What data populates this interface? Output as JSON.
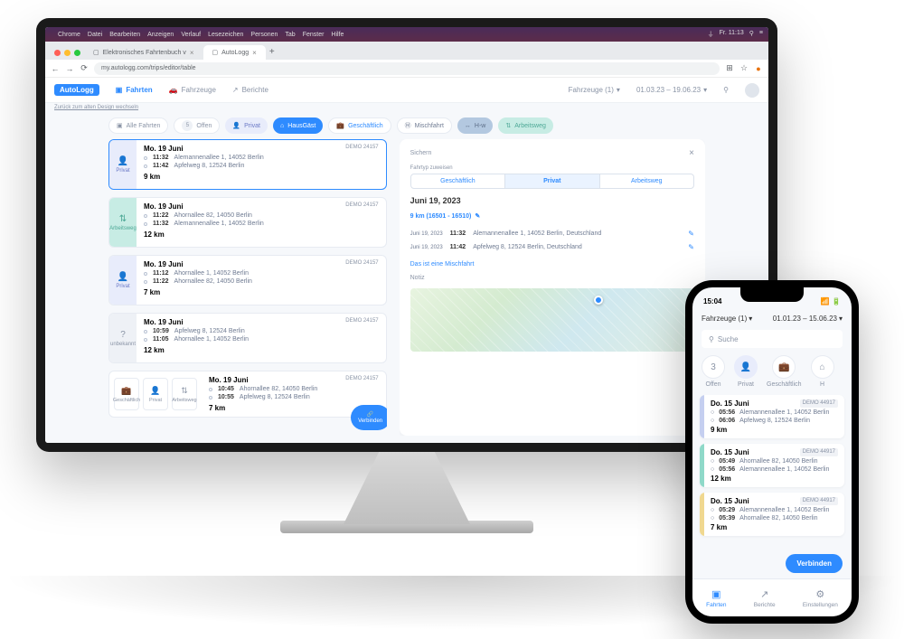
{
  "mac_menu": {
    "app": "Chrome",
    "items": [
      "Datei",
      "Bearbeiten",
      "Anzeigen",
      "Verlauf",
      "Lesezeichen",
      "Personen",
      "Tab",
      "Fenster",
      "Hilfe"
    ],
    "time": "Fr. 11:13"
  },
  "chrome": {
    "tabs": [
      {
        "title": "Elektronisches Fahrtenbuch v"
      },
      {
        "title": "AutoLogg"
      }
    ],
    "url": "my.autologg.com/trips/editor/table"
  },
  "header": {
    "logo": "AutoLogg",
    "nav_fahrten": "Fahrten",
    "nav_fahrzeuge": "Fahrzeuge",
    "nav_berichte": "Berichte",
    "vehicle_sel": "Fahrzeuge (1)",
    "date_range": "01.03.23 – 19.06.23",
    "back_link": "Zurück zum alten Design wechseln"
  },
  "filters": {
    "alle": "Alle Fahrten",
    "offen": "Offen",
    "offen_n": "5",
    "privat": "Privat",
    "hausgast": "HausGäst",
    "geschaeftlich": "Geschäftlich",
    "mischfahrt": "Mischfahrt",
    "hinweg": "H-w",
    "arbeitsweg": "Arbeitsweg"
  },
  "trips": [
    {
      "side": "Privat",
      "date": "Mo. 19 Juni",
      "demo": "DEMO 24157",
      "t1": "11:32",
      "a1": "Alemannenallee 1, 14052 Berlin",
      "t2": "11:42",
      "a2": "Apfelweg 8, 12524 Berlin",
      "km": "9 km"
    },
    {
      "side": "Arbeitsweg",
      "date": "Mo. 19 Juni",
      "demo": "DEMO 24157",
      "t1": "11:22",
      "a1": "Ahornallee 82, 14050 Berlin",
      "t2": "11:32",
      "a2": "Alemannenallee 1, 14052 Berlin",
      "km": "12 km"
    },
    {
      "side": "Privat",
      "date": "Mo. 19 Juni",
      "demo": "DEMO 24157",
      "t1": "11:12",
      "a1": "Ahornallee 1, 14052 Berlin",
      "t2": "11:22",
      "a2": "Ahornallee 82, 14050 Berlin",
      "km": "7 km"
    },
    {
      "side": "unbekannt",
      "date": "Mo. 19 Juni",
      "demo": "DEMO 24157",
      "t1": "10:59",
      "a1": "Apfelweg 8, 12524 Berlin",
      "t2": "11:05",
      "a2": "Ahornallee 1, 14052 Berlin",
      "km": "12 km"
    },
    {
      "side": "",
      "date": "Mo. 19 Juni",
      "demo": "DEMO 24157",
      "t1": "10:45",
      "a1": "Ahornallee 82, 14050 Berlin",
      "t2": "10:55",
      "a2": "Apfelweg 8, 12524 Berlin",
      "km": "7 km"
    }
  ],
  "cat_labels": {
    "ges": "Geschäftlich",
    "priv": "Privat",
    "arb": "Arbeitsweg"
  },
  "verbinden": "Verbinden",
  "detail": {
    "sichern": "Sichern",
    "label_typ": "Fahrtyp zuweisen",
    "seg_ges": "Geschäftlich",
    "seg_priv": "Privat",
    "seg_arb": "Arbeitsweg",
    "date": "Juni 19, 2023",
    "km_line": "9 km (16501 - 16510)",
    "r1_date": "Juni 19, 2023",
    "r1_time": "11:32",
    "r1_loc": "Alemannenallee 1, 14052 Berlin, Deutschland",
    "r2_date": "Juni 19, 2023",
    "r2_time": "11:42",
    "r2_loc": "Apfelweg 8, 12524 Berlin, Deutschland",
    "misch": "Das ist eine Mischfahrt",
    "notiz": "Notiz"
  },
  "phone": {
    "time": "15:04",
    "veh": "Fahrzeuge (1)",
    "range": "01.01.23 – 15.06.23",
    "search": "Suche",
    "chips": {
      "offen": "Offen",
      "offen_n": "3",
      "priv": "Privat",
      "ges": "Geschäftlich",
      "h": "H"
    },
    "trips": [
      {
        "date": "Do. 15 Juni",
        "demo": "DEMO 44917",
        "t1": "05:56",
        "a1": "Alemannenallee 1, 14052 Berlin",
        "t2": "06:06",
        "a2": "Apfelweg 8, 12524 Berlin",
        "km": "9 km"
      },
      {
        "date": "Do. 15 Juni",
        "demo": "DEMO 44917",
        "t1": "05:49",
        "a1": "Ahornallee 82, 14050 Berlin",
        "t2": "05:56",
        "a2": "Alemannenallee 1, 14052 Berlin",
        "km": "12 km"
      },
      {
        "date": "Do. 15 Juni",
        "demo": "DEMO 44917",
        "t1": "05:29",
        "a1": "Alemannenallee 1, 14052 Berlin",
        "t2": "05:39",
        "a2": "Ahornallee 82, 14050 Berlin",
        "km": "7 km"
      }
    ],
    "verbinden": "Verbinden",
    "nav": {
      "fahrten": "Fahrten",
      "berichte": "Berichte",
      "einst": "Einstellungen"
    }
  }
}
